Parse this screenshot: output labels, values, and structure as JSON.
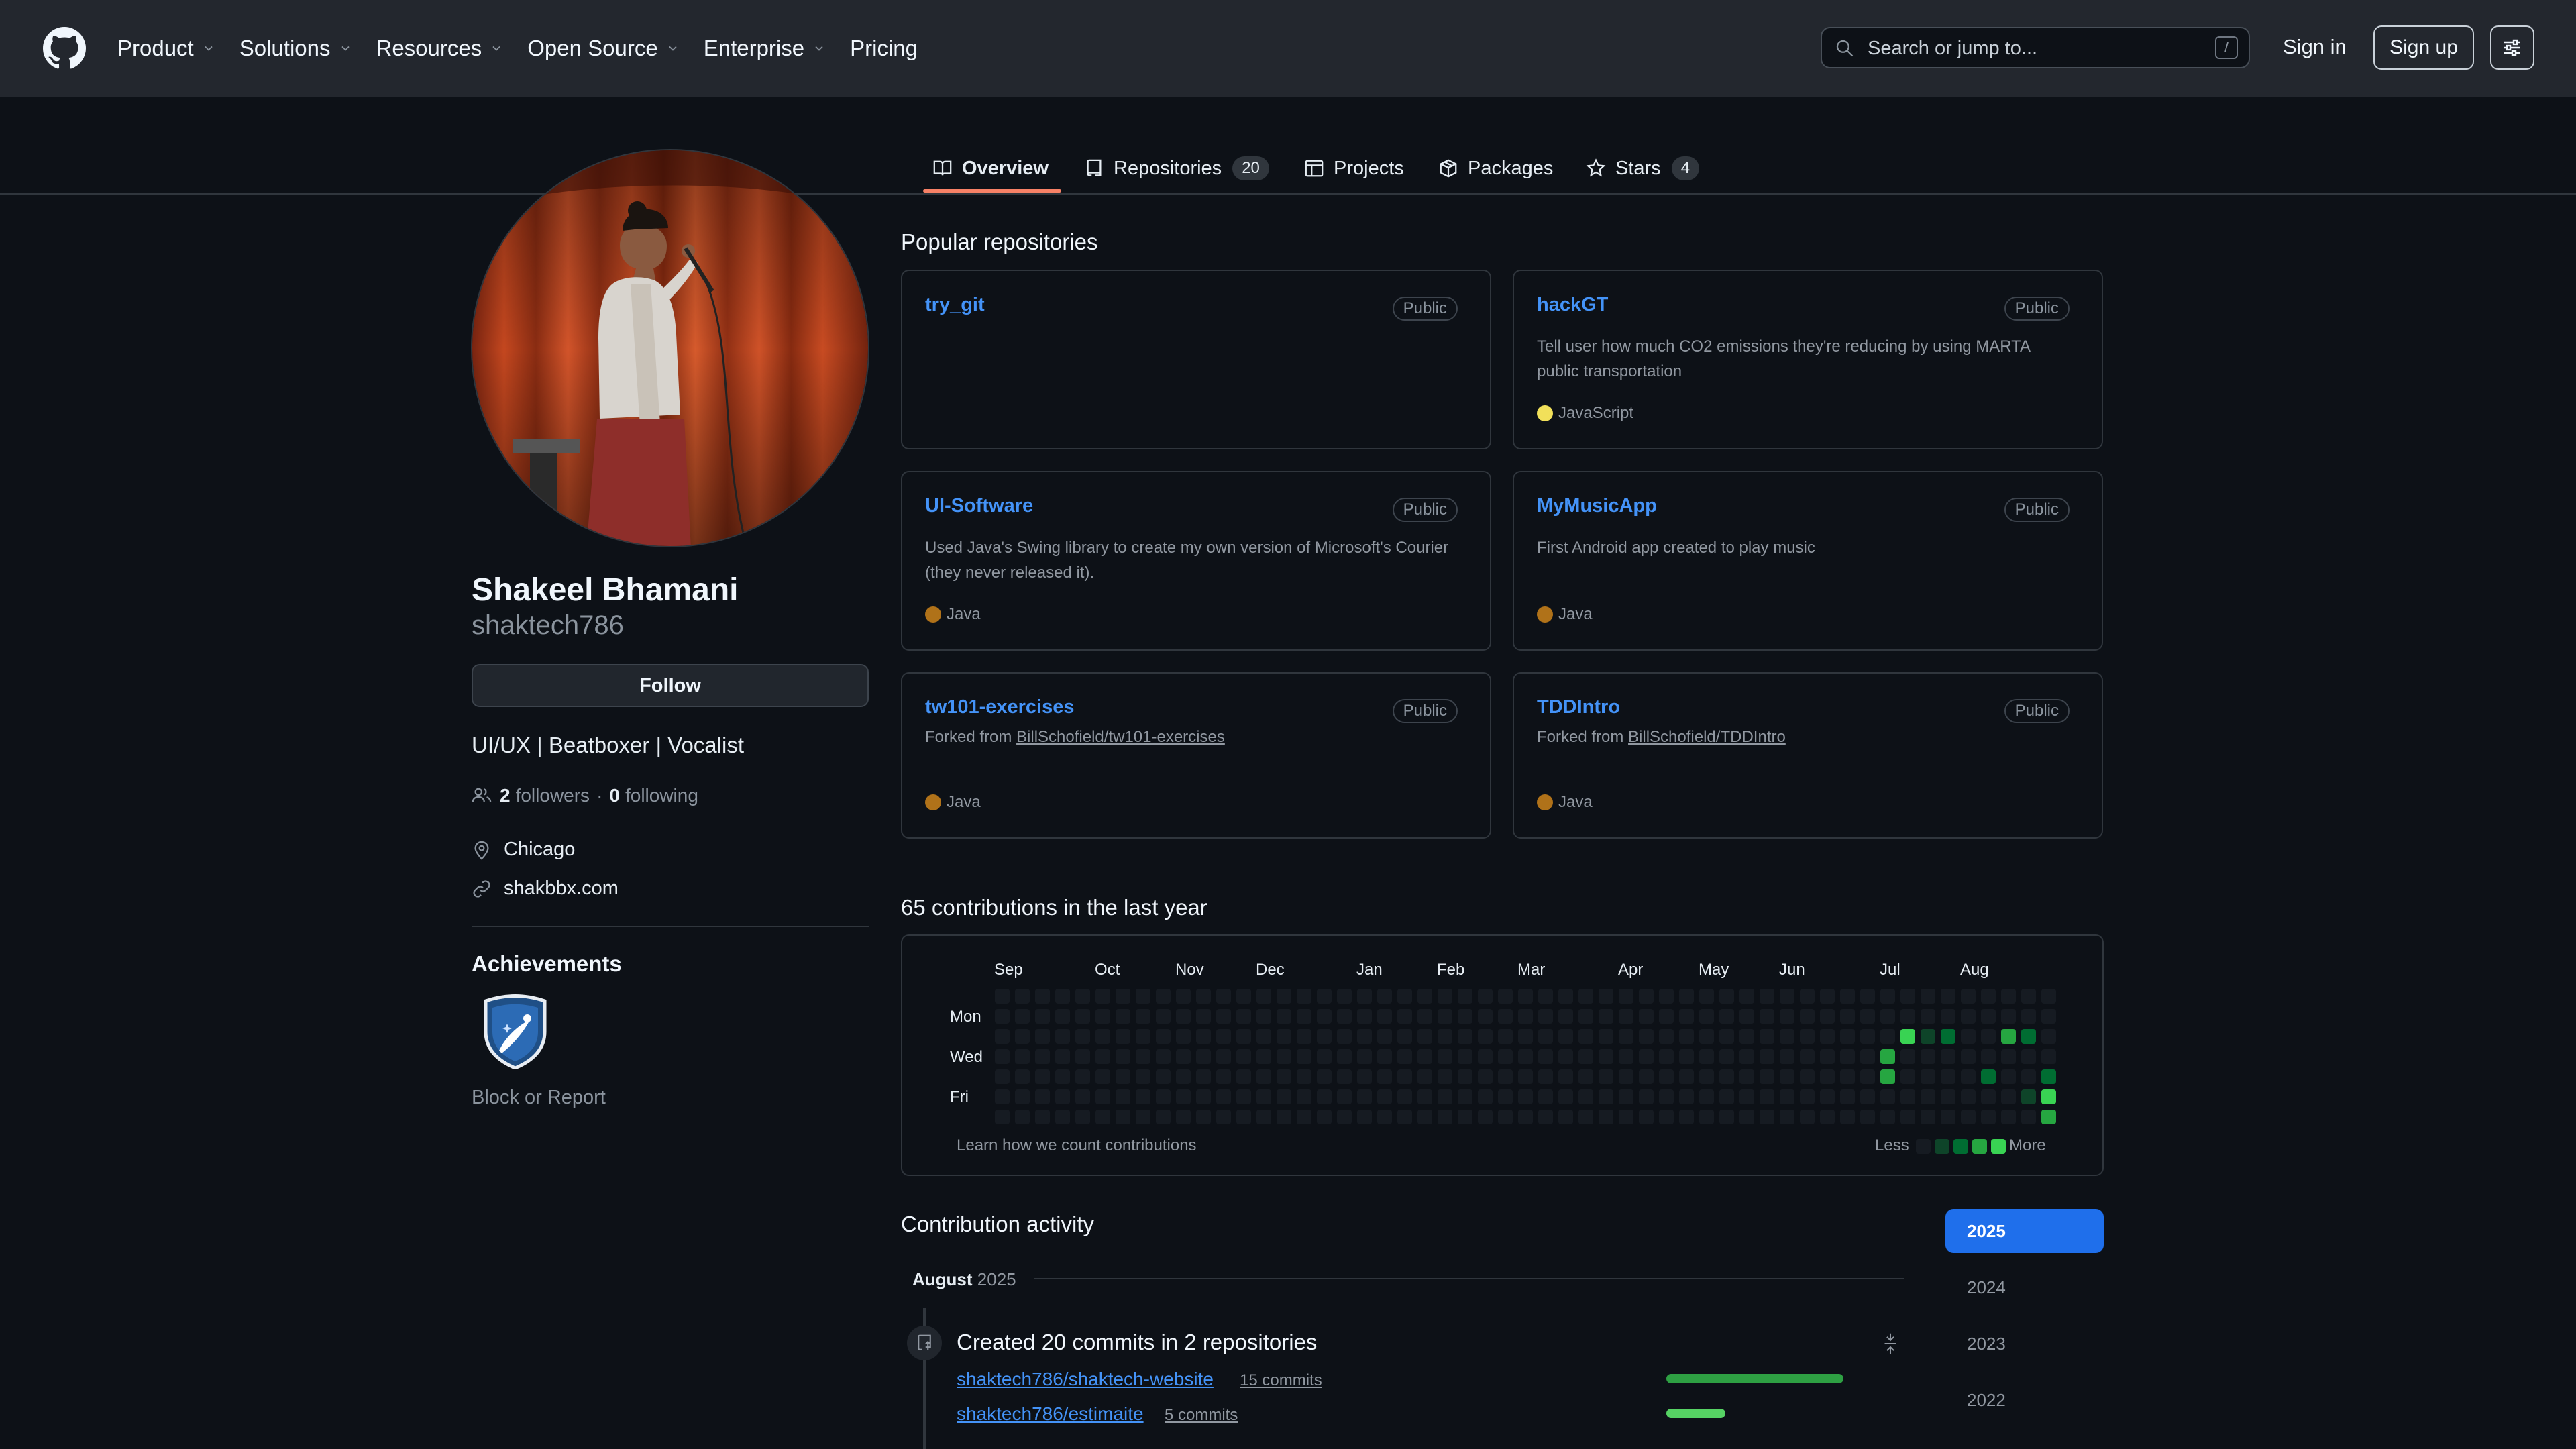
{
  "header": {
    "nav": [
      {
        "label": "Product",
        "dropdown": true
      },
      {
        "label": "Solutions",
        "dropdown": true
      },
      {
        "label": "Resources",
        "dropdown": true
      },
      {
        "label": "Open Source",
        "dropdown": true
      },
      {
        "label": "Enterprise",
        "dropdown": true
      },
      {
        "label": "Pricing",
        "dropdown": false
      }
    ],
    "search_placeholder": "Search or jump to...",
    "search_shortcut": "/",
    "signin": "Sign in",
    "signup": "Sign up"
  },
  "tabs": [
    {
      "label": "Overview",
      "icon": "book-icon",
      "count": ""
    },
    {
      "label": "Repositories",
      "icon": "repo-icon",
      "count": "20"
    },
    {
      "label": "Projects",
      "icon": "table-icon",
      "count": ""
    },
    {
      "label": "Packages",
      "icon": "package-icon",
      "count": ""
    },
    {
      "label": "Stars",
      "icon": "star-icon",
      "count": "4"
    }
  ],
  "profile": {
    "name": "Shakeel Bhamani",
    "username": "shaktech786",
    "follow_label": "Follow",
    "bio": "UI/UX | Beatboxer | Vocalist",
    "followers_count": "2",
    "followers_label": "followers",
    "sep": "·",
    "following_count": "0",
    "following_label": "following",
    "location": "Chicago",
    "website": "shakbbx.com",
    "achievements_title": "Achievements",
    "block_report": "Block or Report"
  },
  "popular": {
    "title": "Popular repositories",
    "repos": [
      {
        "name": "try_git",
        "visibility": "Public",
        "description": "",
        "fork_prefix": "",
        "fork_source": "",
        "language": "",
        "language_color": ""
      },
      {
        "name": "hackGT",
        "visibility": "Public",
        "description": "Tell user how much CO2 emissions they're reducing by using MARTA public transportation",
        "fork_prefix": "",
        "fork_source": "",
        "language": "JavaScript",
        "language_color": "#f1e05a"
      },
      {
        "name": "UI-Software",
        "visibility": "Public",
        "description": "Used Java's Swing library to create my own version of Microsoft's Courier (they never released it).",
        "fork_prefix": "",
        "fork_source": "",
        "language": "Java",
        "language_color": "#b07219"
      },
      {
        "name": "MyMusicApp",
        "visibility": "Public",
        "description": "First Android app created to play music",
        "fork_prefix": "",
        "fork_source": "",
        "language": "Java",
        "language_color": "#b07219"
      },
      {
        "name": "tw101-exercises",
        "visibility": "Public",
        "description": "",
        "fork_prefix": "Forked from",
        "fork_source": "BillSchofield/tw101-exercises",
        "language": "Java",
        "language_color": "#b07219"
      },
      {
        "name": "TDDIntro",
        "visibility": "Public",
        "description": "",
        "fork_prefix": "Forked from",
        "fork_source": "BillSchofield/TDDIntro",
        "language": "Java",
        "language_color": "#b07219"
      }
    ]
  },
  "contributions": {
    "title": "65 contributions in the last year",
    "months": [
      "Sep",
      "Oct",
      "Nov",
      "Dec",
      "Jan",
      "Feb",
      "Mar",
      "Apr",
      "May",
      "Jun",
      "Jul",
      "Aug"
    ],
    "day_labels": [
      "Mon",
      "Wed",
      "Fri"
    ],
    "learn_link": "Learn how we count contributions",
    "legend_less": "Less",
    "legend_more": "More",
    "level_colors": [
      "#161b22",
      "#0e4429",
      "#006d32",
      "#26a641",
      "#39d353"
    ],
    "weeks": 53,
    "active_cells": [
      {
        "week": 44,
        "day": 3,
        "level": 3
      },
      {
        "week": 44,
        "day": 4,
        "level": 3
      },
      {
        "week": 45,
        "day": 2,
        "level": 4
      },
      {
        "week": 46,
        "day": 2,
        "level": 1
      },
      {
        "week": 47,
        "day": 2,
        "level": 2
      },
      {
        "week": 49,
        "day": 4,
        "level": 2
      },
      {
        "week": 50,
        "day": 2,
        "level": 3
      },
      {
        "week": 51,
        "day": 2,
        "level": 2
      },
      {
        "week": 51,
        "day": 5,
        "level": 1
      },
      {
        "week": 52,
        "day": 4,
        "level": 2
      },
      {
        "week": 52,
        "day": 5,
        "level": 4
      },
      {
        "week": 52,
        "day": 6,
        "level": 3
      }
    ]
  },
  "activity": {
    "title": "Contribution activity",
    "years": [
      "2025",
      "2024",
      "2023",
      "2022"
    ],
    "active_year": "2025",
    "month": "August",
    "month_year": "2025",
    "event_title": "Created 20 commits in 2 repositories",
    "repos": [
      {
        "name": "shaktech786/shaktech-website",
        "commits": "15 commits",
        "share": 0.75
      },
      {
        "name": "shaktech786/estimaite",
        "commits": "5 commits",
        "share": 0.25
      }
    ]
  }
}
